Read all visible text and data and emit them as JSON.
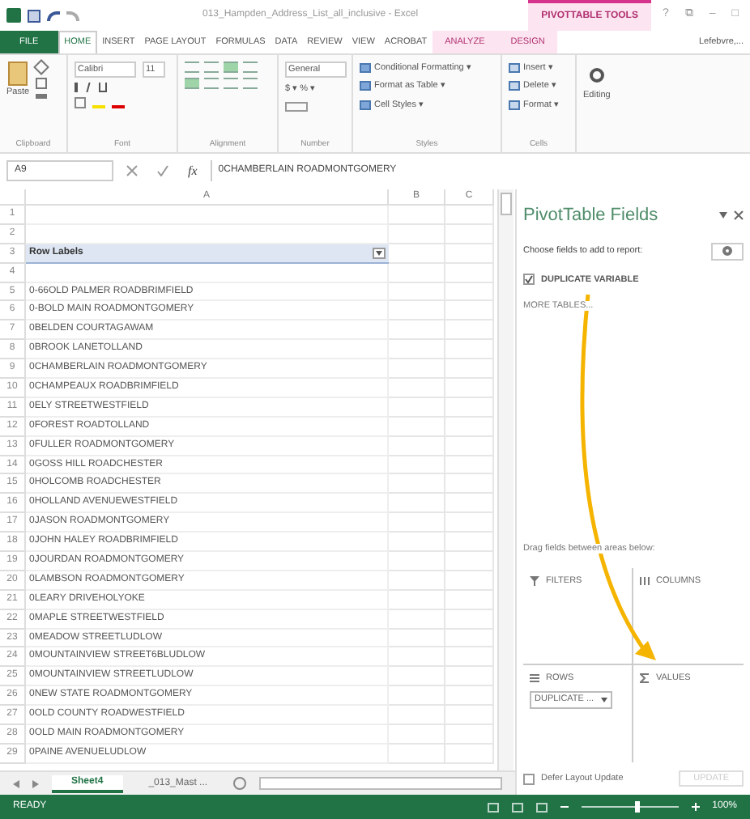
{
  "title_bar": {
    "title": "013_Hampden_Address_List_all_inclusive - Excel",
    "contextual_group": "PIVOTTABLE TOOLS",
    "controls": [
      "?",
      "⧉",
      "–",
      "□"
    ]
  },
  "ribbon_tabs": [
    {
      "label": "FILE",
      "kind": "file",
      "selected": false
    },
    {
      "label": "HOME",
      "kind": "normal",
      "selected": true
    },
    {
      "label": "INSERT",
      "kind": "normal",
      "selected": false
    },
    {
      "label": "PAGE LAYOUT",
      "kind": "normal",
      "selected": false
    },
    {
      "label": "FORMULAS",
      "kind": "normal",
      "selected": false
    },
    {
      "label": "DATA",
      "kind": "normal",
      "selected": false
    },
    {
      "label": "REVIEW",
      "kind": "normal",
      "selected": false
    },
    {
      "label": "VIEW",
      "kind": "normal",
      "selected": false
    },
    {
      "label": "ACROBAT",
      "kind": "normal",
      "selected": false
    },
    {
      "label": "ANALYZE",
      "kind": "contextual",
      "selected": false
    },
    {
      "label": "DESIGN",
      "kind": "contextual",
      "selected": false
    }
  ],
  "account": "Lefebvre,...",
  "ribbon": {
    "paste": "Paste",
    "font_name": "Calibri",
    "font_size": "11",
    "number_format": "General",
    "currency": "$ ▾ % ▾",
    "styles": [
      "Conditional Formatting ▾",
      "Format as Table ▾",
      "Cell Styles ▾"
    ],
    "cells": [
      "Insert ▾",
      "Delete ▾",
      "Format ▾"
    ],
    "editing": "Editing",
    "groups": [
      "Clipboard",
      "Font",
      "Alignment",
      "Number",
      "Styles",
      "Cells"
    ]
  },
  "formula_bar": {
    "name_box": "A9",
    "function_label": "fx",
    "formula": "0CHAMBERLAIN ROADMONTGOMERY"
  },
  "sheet": {
    "columns": [
      "A",
      "B",
      "C"
    ],
    "rows": [
      {
        "number": "1"
      },
      {
        "number": "2"
      },
      {
        "number": "3",
        "kind": "header",
        "value": "Row Labels"
      },
      {
        "number": "4"
      },
      {
        "number": "5",
        "value": "0-66OLD PALMER ROADBRIMFIELD"
      },
      {
        "number": "6",
        "value": "0-BOLD MAIN ROADMONTGOMERY"
      },
      {
        "number": "7",
        "value": "0BELDEN COURTAGAWAM"
      },
      {
        "number": "8",
        "value": "0BROOK LANETOLLAND"
      },
      {
        "number": "9",
        "value": "0CHAMBERLAIN ROADMONTGOMERY"
      },
      {
        "number": "10",
        "value": "0CHAMPEAUX ROADBRIMFIELD"
      },
      {
        "number": "11",
        "value": "0ELY STREETWESTFIELD"
      },
      {
        "number": "12",
        "value": "0FOREST ROADTOLLAND"
      },
      {
        "number": "13",
        "value": "0FULLER ROADMONTGOMERY"
      },
      {
        "number": "14",
        "value": "0GOSS HILL ROADCHESTER"
      },
      {
        "number": "15",
        "value": "0HOLCOMB ROADCHESTER"
      },
      {
        "number": "16",
        "value": "0HOLLAND AVENUEWESTFIELD"
      },
      {
        "number": "17",
        "value": "0JASON ROADMONTGOMERY"
      },
      {
        "number": "18",
        "value": "0JOHN HALEY ROADBRIMFIELD"
      },
      {
        "number": "19",
        "value": "0JOURDAN ROADMONTGOMERY"
      },
      {
        "number": "20",
        "value": "0LAMBSON ROADMONTGOMERY"
      },
      {
        "number": "21",
        "value": "0LEARY DRIVEHOLYOKE"
      },
      {
        "number": "22",
        "value": "0MAPLE STREETWESTFIELD"
      },
      {
        "number": "23",
        "value": "0MEADOW STREETLUDLOW"
      },
      {
        "number": "24",
        "value": "0MOUNTAINVIEW STREET6BLUDLOW"
      },
      {
        "number": "25",
        "value": "0MOUNTAINVIEW STREETLUDLOW"
      },
      {
        "number": "26",
        "value": "0NEW STATE ROADMONTGOMERY"
      },
      {
        "number": "27",
        "value": "0OLD COUNTY ROADWESTFIELD"
      },
      {
        "number": "28",
        "value": "0OLD MAIN ROADMONTGOMERY"
      },
      {
        "number": "29",
        "value": "0PAINE AVENUELUDLOW"
      }
    ]
  },
  "sheet_tabs": [
    {
      "label": "Sheet4",
      "selected": true
    },
    {
      "label": "_013_Mast ...",
      "selected": false
    }
  ],
  "pivot_pane": {
    "title": "PivotTable Fields",
    "subtitle": "Choose fields to add to report:",
    "fields": [
      {
        "label": "DUPLICATE VARIABLE",
        "checked": true
      }
    ],
    "more_tables": "MORE TABLES...",
    "drag_hint": "Drag fields between areas below:",
    "areas": [
      {
        "label": "FILTERS",
        "kind": "filters"
      },
      {
        "label": "COLUMNS",
        "kind": "columns"
      },
      {
        "label": "ROWS",
        "kind": "rows",
        "items": [
          "DUPLICATE ..."
        ]
      },
      {
        "label": "VALUES",
        "kind": "values"
      }
    ],
    "defer": {
      "label": "Defer Layout Update",
      "checked": false
    },
    "update_button": {
      "label": "UPDATE",
      "disabled": true
    }
  },
  "status_bar": {
    "status": "READY",
    "zoom": {
      "level": 0.55
    },
    "zoom_label": "100%"
  }
}
